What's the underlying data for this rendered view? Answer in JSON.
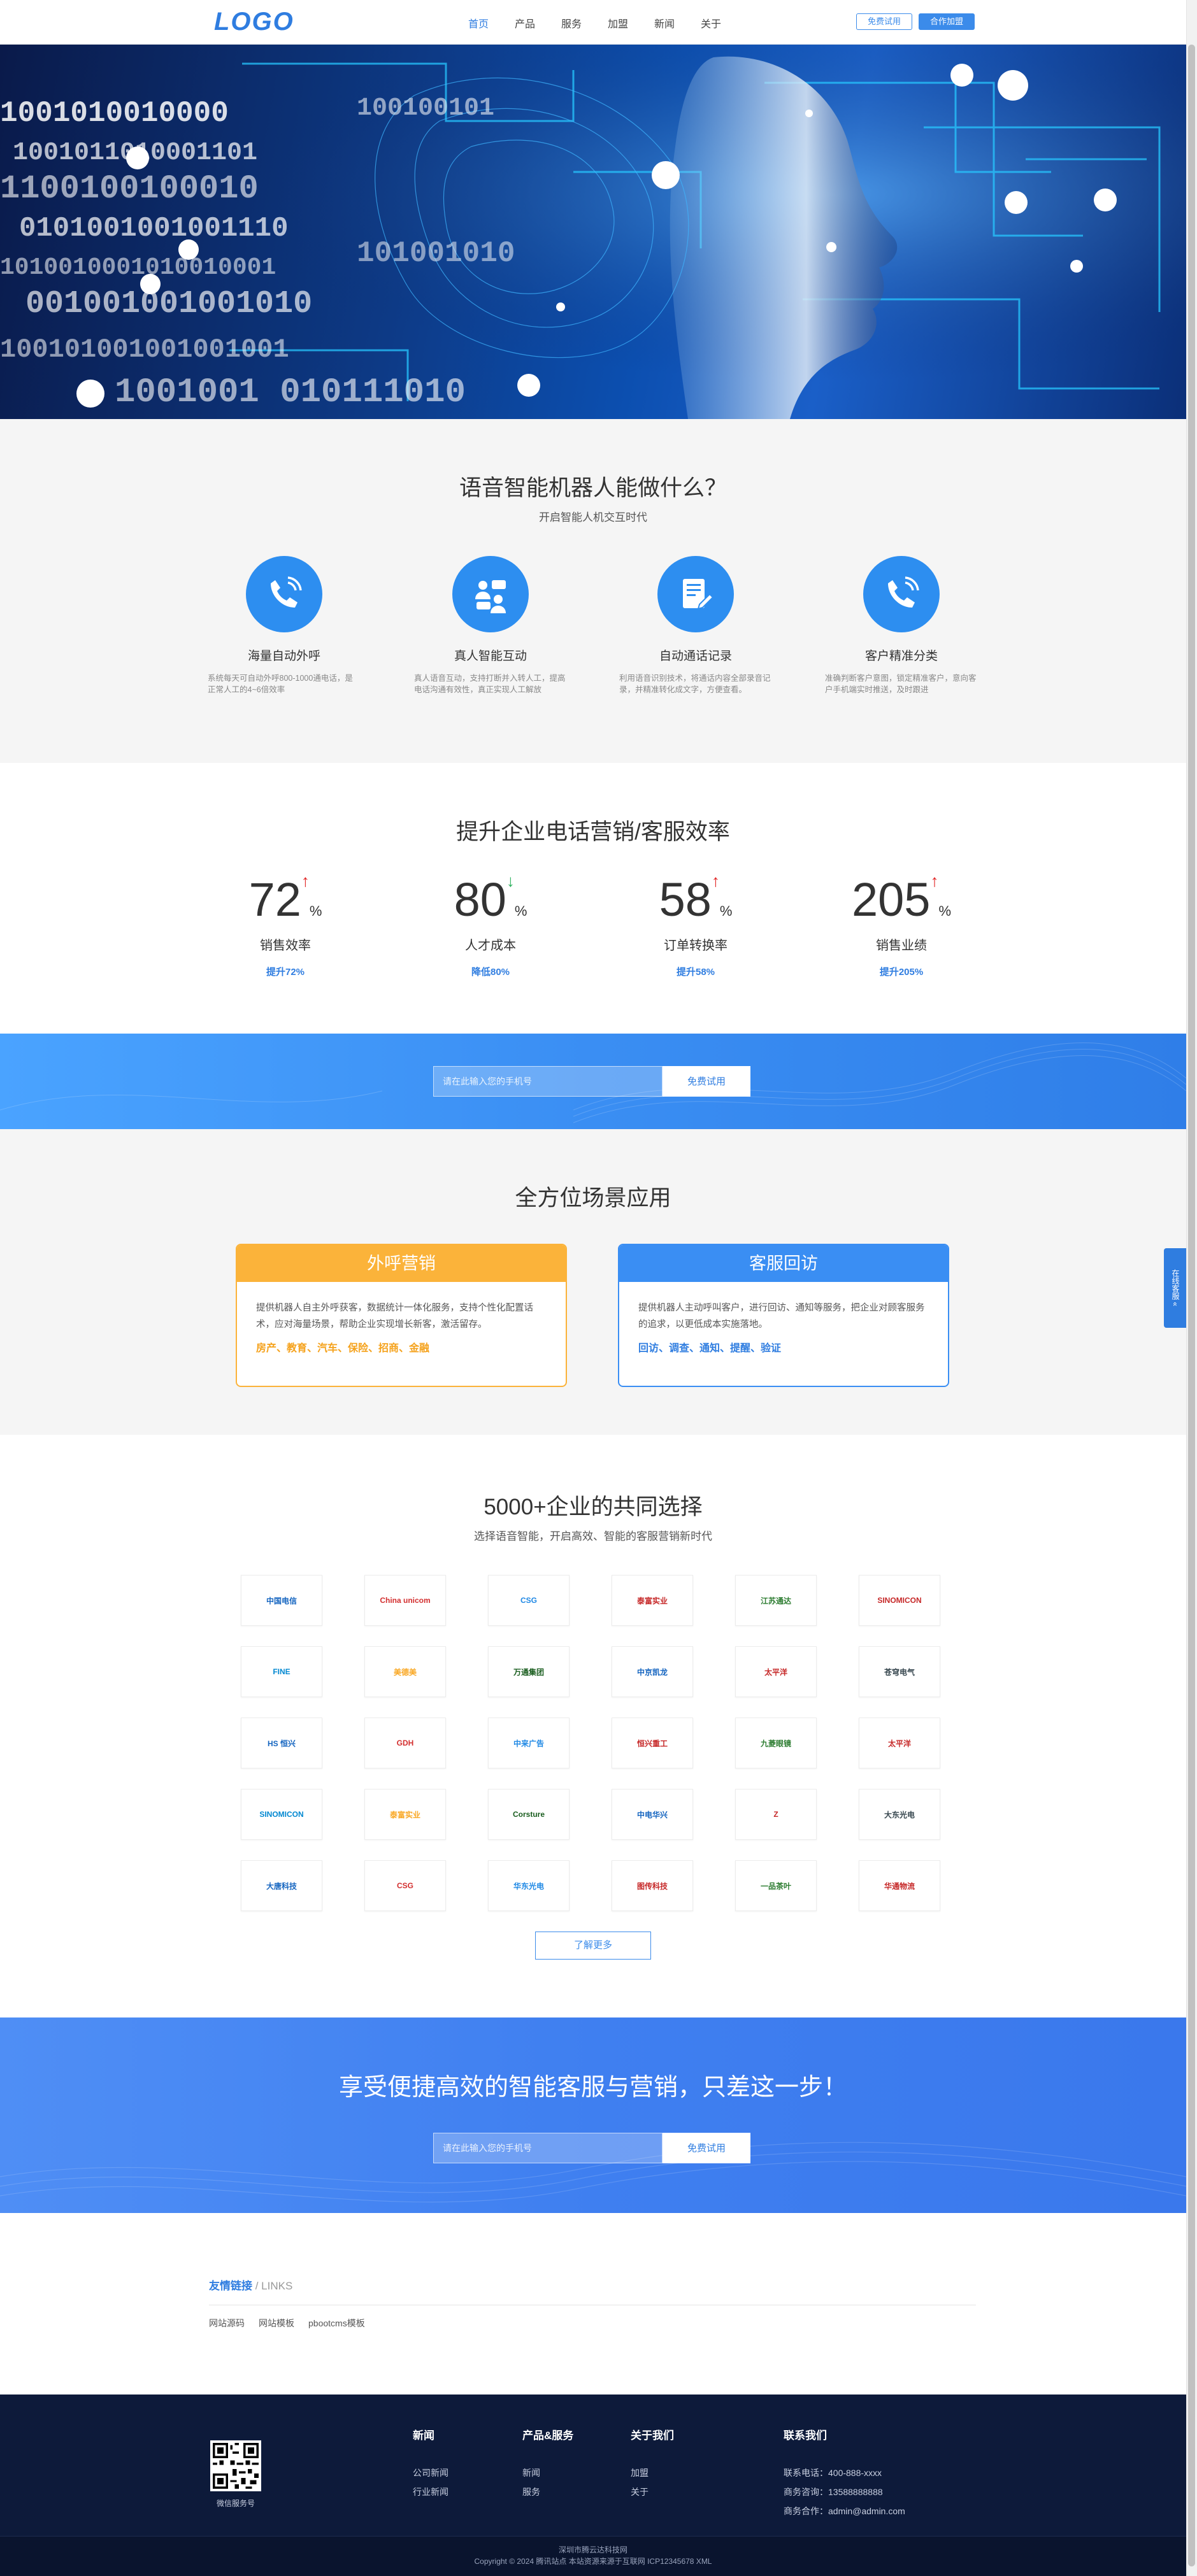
{
  "header": {
    "logo": "LOGO",
    "nav": [
      "首页",
      "产品",
      "服务",
      "加盟",
      "新闻",
      "关于"
    ],
    "btn_trial": "免费试用",
    "btn_partner": "合作加盟"
  },
  "ability": {
    "title": "语音智能机器人能做什么？",
    "subtitle": "开启智能人机交互时代",
    "features": [
      {
        "icon": "phone-call-icon",
        "title": "海量自动外呼",
        "desc": "系统每天可自动外呼800-1000通电话，是正常人工的4~6倍效率"
      },
      {
        "icon": "chat-people-icon",
        "title": "真人智能互动",
        "desc": "真人语音互动，支持打断并入转人工，提高电话沟通有效性，真正实现人工解放"
      },
      {
        "icon": "document-edit-icon",
        "title": "自动通话记录",
        "desc": "利用语音识别技术，将通话内容全部录音记录，并精准转化成文字，方便查看。"
      },
      {
        "icon": "phone-call-icon",
        "title": "客户精准分类",
        "desc": "准确判断客户意图，锁定精准客户，意向客户手机端实时推送，及时跟进"
      }
    ]
  },
  "stats": {
    "title": "提升企业电话营销/客服效率",
    "items": [
      {
        "num": "72",
        "unit": "%",
        "dir": "up",
        "label": "销售效率",
        "change": "提升72%"
      },
      {
        "num": "80",
        "unit": "%",
        "dir": "down",
        "label": "人才成本",
        "change": "降低80%"
      },
      {
        "num": "58",
        "unit": "%",
        "dir": "up",
        "label": "订单转换率",
        "change": "提升58%"
      },
      {
        "num": "205",
        "unit": "%",
        "dir": "up",
        "label": "销售业绩",
        "change": "提升205%"
      }
    ]
  },
  "try1": {
    "placeholder": "请在此输入您的手机号",
    "button": "免费试用"
  },
  "scenes": {
    "title": "全方位场景应用",
    "cards": [
      {
        "title": "外呼营销",
        "desc": "提供机器人自主外呼获客，数据统计一体化服务，支持个性化配置话术，应对海量场景，帮助企业实现增长新客，激活留存。",
        "tags": "房产、教育、汽车、保险、招商、金融",
        "color": "#fbb33a"
      },
      {
        "title": "客服回访",
        "desc": "提供机器人主动呼叫客户，进行回访、通知等服务，把企业对顾客服务的追求，以更低成本实施落地。",
        "tags": "回访、调查、通知、提醒、验证",
        "color": "#3a8ef3"
      }
    ]
  },
  "clients": {
    "title": "5000+企业的共同选择",
    "subtitle": "选择语音智能，开启高效、智能的客服营销新时代",
    "logos": [
      "中国电信",
      "China unicom",
      "CSG",
      "泰富实业",
      "江苏通达",
      "SINOMICON",
      "FINE",
      "美德美",
      "万通集团",
      "中京凯龙",
      "太平洋",
      "苍穹电气",
      "HS 恒兴",
      "GDH",
      "中来广告",
      "恒兴重工",
      "九菱眼镜",
      "太平洋",
      "SINOMICON",
      "泰富实业",
      "Corsture",
      "中电华兴",
      "Z",
      "大东光电",
      "大唐科技",
      "CSG",
      "华东光电",
      "图传科技",
      "一品茶叶",
      "华通物流"
    ],
    "more": "了解更多"
  },
  "cta": {
    "title": "享受便捷高效的智能客服与营销，只差这一步！",
    "placeholder": "请在此输入您的手机号",
    "button": "免费试用"
  },
  "links": {
    "head": "友情链接",
    "head_en": "/ LINKS",
    "items": [
      "网站源码",
      "网站模板",
      "pbootcms模板"
    ]
  },
  "footer": {
    "qr_caption": "微信服务号",
    "cols": [
      {
        "title": "新闻",
        "items": [
          "公司新闻",
          "行业新闻"
        ]
      },
      {
        "title": "产品&服务",
        "items": [
          "新闻",
          "服务"
        ]
      },
      {
        "title": "关于我们",
        "items": [
          "加盟",
          "关于"
        ]
      }
    ],
    "contact_title": "联系我们",
    "contact": [
      "联系电话：400-888-xxxx",
      "商务咨询：13588888888",
      "商务合作：admin@admin.com"
    ],
    "copy1": "深圳市腾云达科技网",
    "copy2": "Copyright © 2024 腾讯站点 本站资源来源于互联网 ICP12345678 XML"
  },
  "side_float": "在线客服"
}
